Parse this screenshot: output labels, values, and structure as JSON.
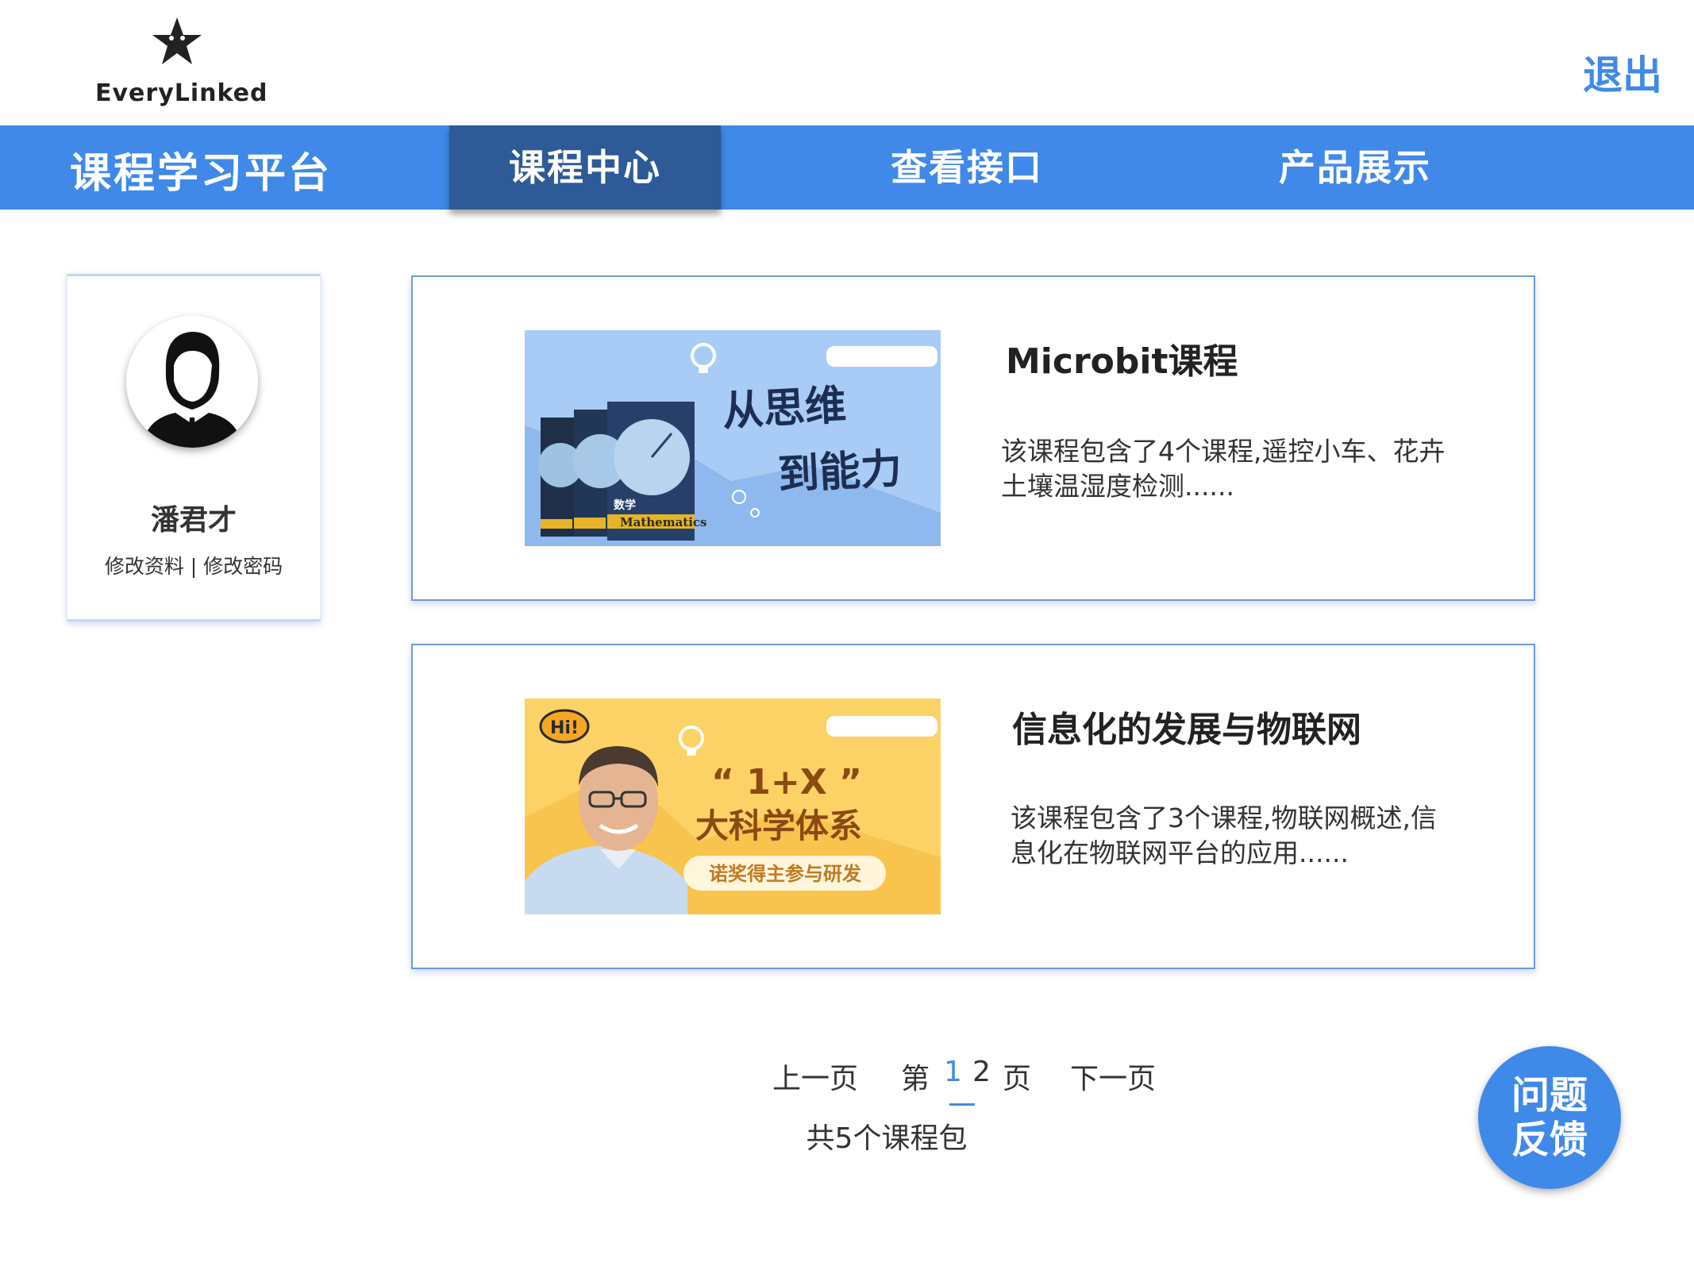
{
  "header": {
    "logo_text": "EveryLinked",
    "logout_label": "退出"
  },
  "nav": {
    "brand": "课程学习平台",
    "items": [
      {
        "label": "课程中心",
        "active": true
      },
      {
        "label": "查看接口",
        "active": false
      },
      {
        "label": "产品展示",
        "active": false
      }
    ]
  },
  "profile": {
    "name": "潘君才",
    "edit_info": "修改资料",
    "separator": "|",
    "change_password": "修改密码"
  },
  "courses": [
    {
      "title": "Microbit课程",
      "description": "该课程包含了4个课程,遥控小车、花卉土壤温湿度检测......",
      "image_text": [
        "从思维",
        "到能力"
      ],
      "book_labels": [
        "数学",
        "Mathematics"
      ]
    },
    {
      "title": "信息化的发展与物联网",
      "description": "该课程包含了3个课程,物联网概述,信息化在物联网平台的应用......",
      "image_text": [
        "Hi!",
        "“ 1+X ”",
        "大科学体系",
        "诺奖得主参与研发"
      ]
    }
  ],
  "pagination": {
    "prev": "上一页",
    "page_prefix": "第",
    "pages": [
      "1",
      "2"
    ],
    "current_page": "1",
    "page_suffix": "页",
    "next": "下一页",
    "total": "共5个课程包"
  },
  "feedback": {
    "line1": "问题",
    "line2": "反馈"
  },
  "colors": {
    "accent": "#4089e8",
    "nav_active": "#2e5a97",
    "card_border": "#6e9bdc"
  }
}
